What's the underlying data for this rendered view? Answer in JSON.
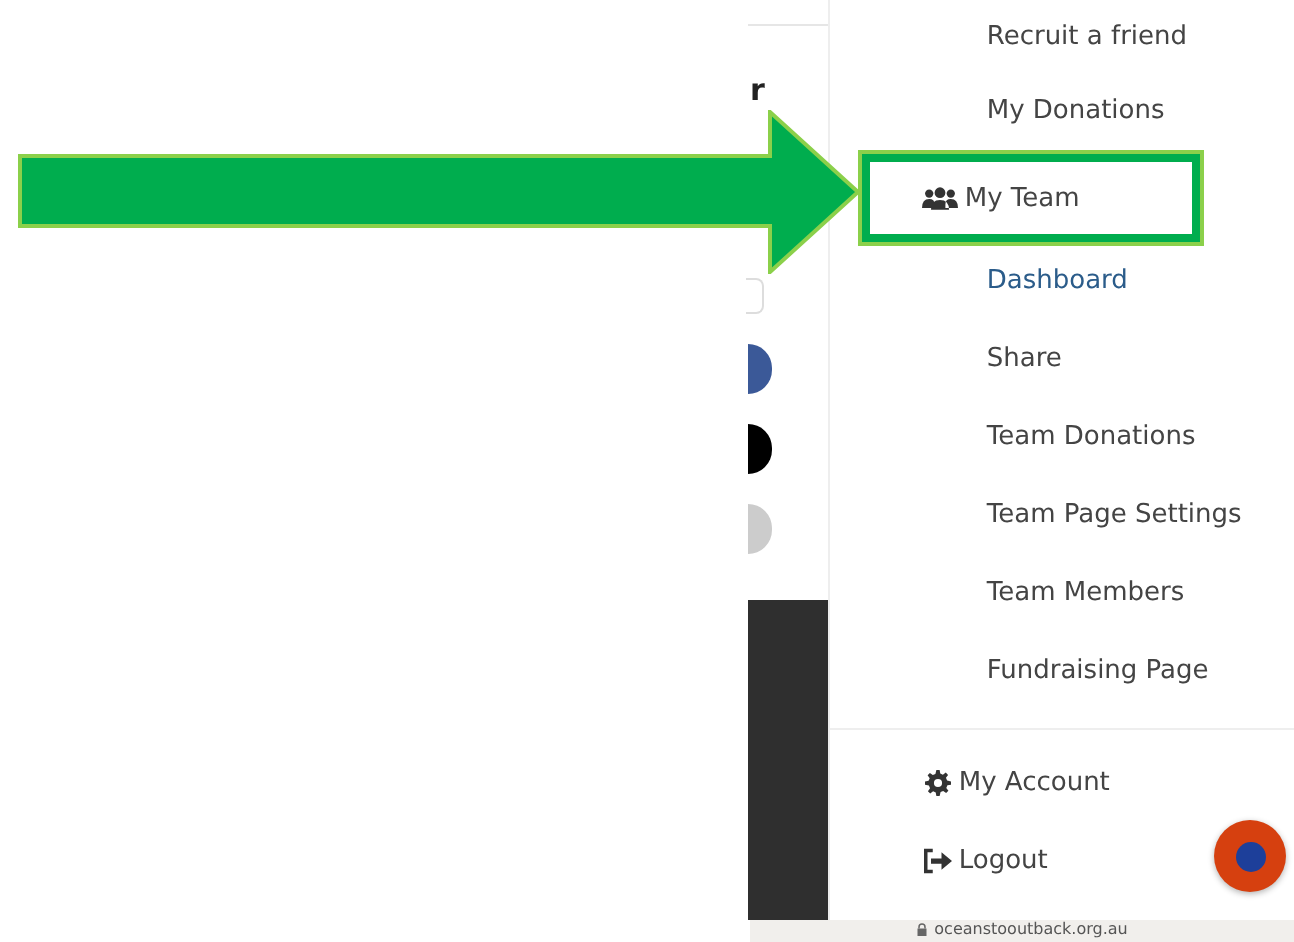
{
  "page_edge": {
    "heading_fragment": "r",
    "share_dots": [
      {
        "color": "#3b5998"
      },
      {
        "color": "#000000"
      },
      {
        "color": "#cccccc"
      }
    ]
  },
  "menu": {
    "items": [
      {
        "label": "Recruit a friend",
        "kind": "plain",
        "selected": false,
        "highlighted": false
      },
      {
        "label": "My Donations",
        "kind": "plain",
        "selected": false,
        "highlighted": false
      },
      {
        "label": "My Team",
        "kind": "users",
        "selected": false,
        "highlighted": true
      },
      {
        "label": "Dashboard",
        "kind": "plain",
        "selected": true,
        "highlighted": false
      },
      {
        "label": "Share",
        "kind": "plain",
        "selected": false,
        "highlighted": false
      },
      {
        "label": "Team Donations",
        "kind": "plain",
        "selected": false,
        "highlighted": false
      },
      {
        "label": "Team Page Settings",
        "kind": "plain",
        "selected": false,
        "highlighted": false
      },
      {
        "label": "Team Members",
        "kind": "plain",
        "selected": false,
        "highlighted": false
      },
      {
        "label": "Fundraising Page",
        "kind": "plain",
        "selected": false,
        "highlighted": false
      }
    ],
    "footer_items": [
      {
        "label": "My Account",
        "kind": "gear"
      },
      {
        "label": "Logout",
        "kind": "exit"
      }
    ]
  },
  "address_bar": {
    "url": "oceanstooutback.org.au"
  }
}
